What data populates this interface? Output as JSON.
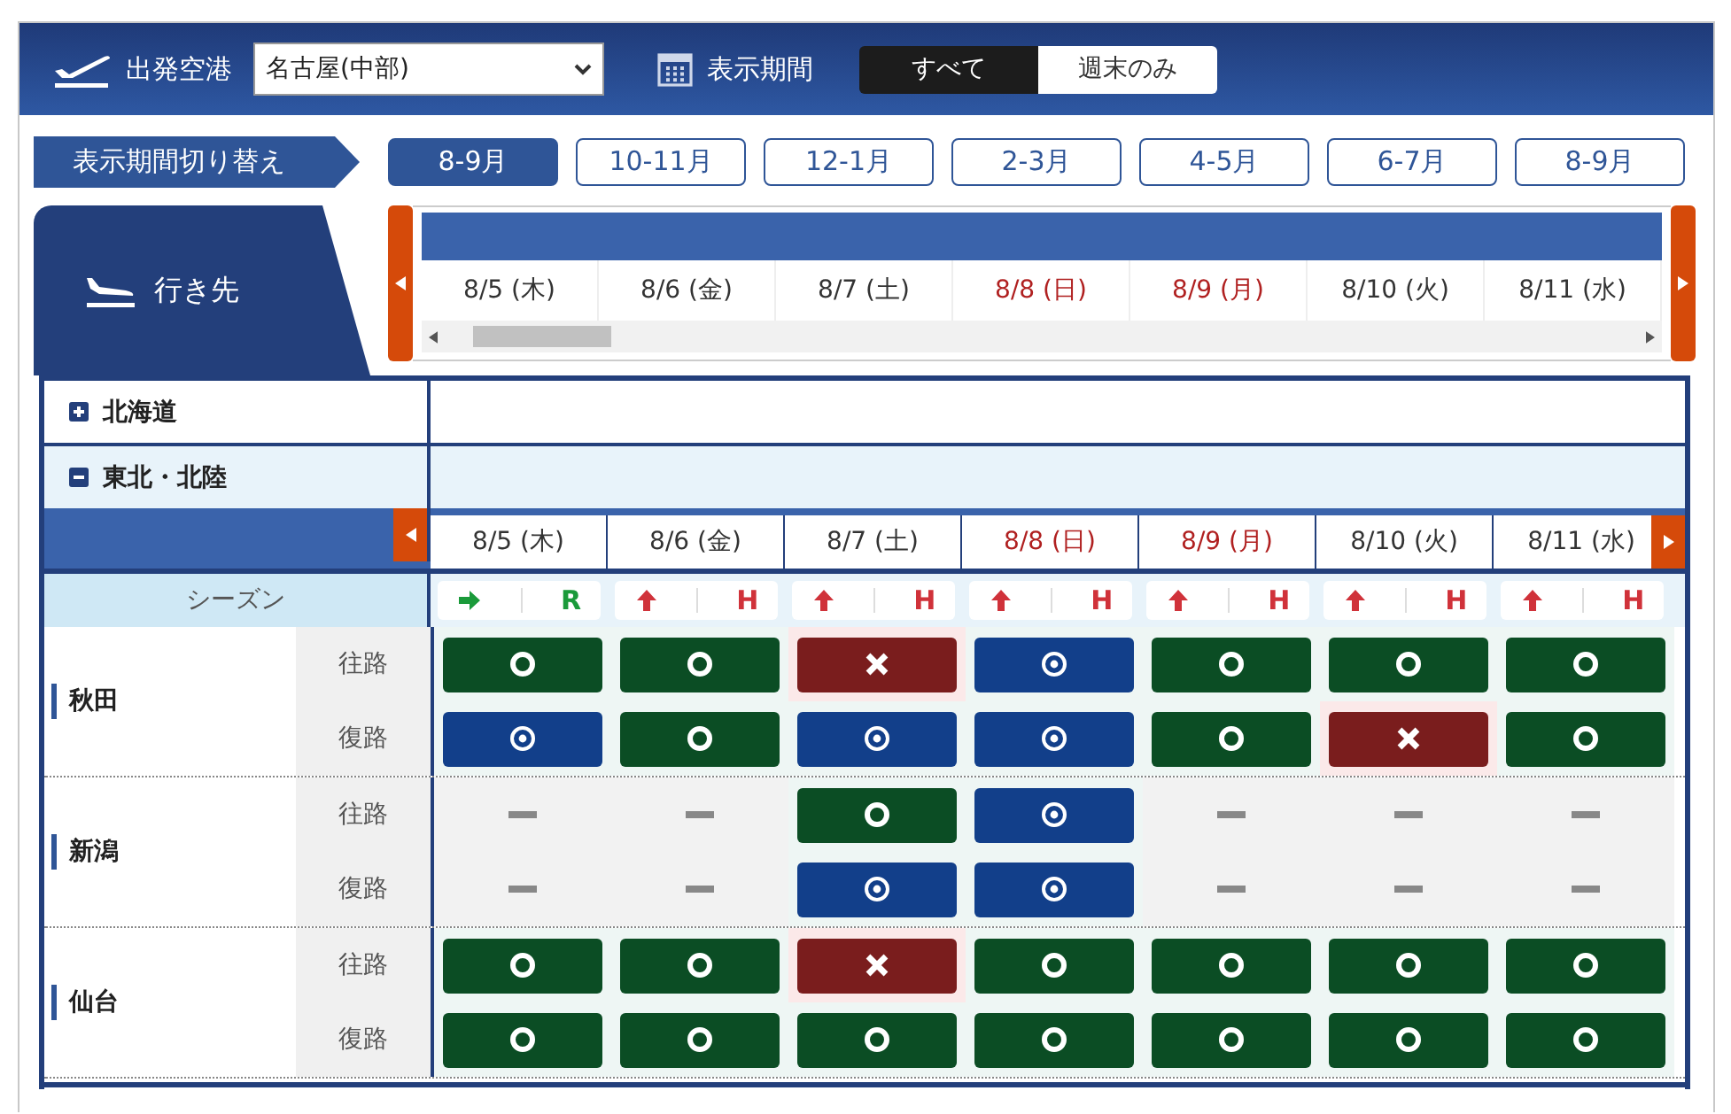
{
  "header": {
    "departure_label": "出発空港",
    "departure_value": "名古屋(中部)",
    "period_label": "表示期間",
    "period_options": [
      {
        "label": "すべて",
        "selected": true
      },
      {
        "label": "週末のみ",
        "selected": false
      }
    ]
  },
  "period_switch": {
    "label": "表示期間切り替え",
    "tabs": [
      {
        "label": "8-9月",
        "selected": true
      },
      {
        "label": "10-11月",
        "selected": false
      },
      {
        "label": "12-1月",
        "selected": false
      },
      {
        "label": "2-3月",
        "selected": false
      },
      {
        "label": "4-5月",
        "selected": false
      },
      {
        "label": "6-7月",
        "selected": false
      },
      {
        "label": "8-9月",
        "selected": false
      }
    ]
  },
  "destination_tab": {
    "label": "行き先"
  },
  "date_strip": [
    {
      "label": "8/5 (木)",
      "holiday": false
    },
    {
      "label": "8/6 (金)",
      "holiday": false
    },
    {
      "label": "8/7 (土)",
      "holiday": false
    },
    {
      "label": "8/8 (日)",
      "holiday": true
    },
    {
      "label": "8/9 (月)",
      "holiday": true
    },
    {
      "label": "8/10 (火)",
      "holiday": false
    },
    {
      "label": "8/11 (水)",
      "holiday": false
    }
  ],
  "regions": [
    {
      "name": "北海道",
      "expanded": false
    },
    {
      "name": "東北・北陸",
      "expanded": true,
      "dates": [
        {
          "label": "8/5 (木)",
          "holiday": false
        },
        {
          "label": "8/6 (金)",
          "holiday": false
        },
        {
          "label": "8/7 (土)",
          "holiday": false
        },
        {
          "label": "8/8 (日)",
          "holiday": true
        },
        {
          "label": "8/9 (月)",
          "holiday": true
        },
        {
          "label": "8/10 (火)",
          "holiday": false
        },
        {
          "label": "8/11 (水)",
          "holiday": false
        }
      ],
      "season_label": "シーズン",
      "seasons": [
        {
          "kind": "right",
          "code": "R"
        },
        {
          "kind": "up",
          "code": "H"
        },
        {
          "kind": "up",
          "code": "H"
        },
        {
          "kind": "up",
          "code": "H"
        },
        {
          "kind": "up",
          "code": "H"
        },
        {
          "kind": "up",
          "code": "H"
        },
        {
          "kind": "up",
          "code": "H"
        }
      ],
      "cities": [
        {
          "name": "秋田",
          "routes": [
            {
              "label": "往路",
              "cells": [
                {
                  "kind": "circle"
                },
                {
                  "kind": "circle"
                },
                {
                  "kind": "cross"
                },
                {
                  "kind": "double"
                },
                {
                  "kind": "circle"
                },
                {
                  "kind": "circle"
                },
                {
                  "kind": "circle"
                }
              ]
            },
            {
              "label": "復路",
              "cells": [
                {
                  "kind": "double"
                },
                {
                  "kind": "circle"
                },
                {
                  "kind": "double"
                },
                {
                  "kind": "double"
                },
                {
                  "kind": "circle"
                },
                {
                  "kind": "cross"
                },
                {
                  "kind": "circle"
                }
              ]
            }
          ]
        },
        {
          "name": "新潟",
          "routes": [
            {
              "label": "往路",
              "cells": [
                {
                  "kind": "none"
                },
                {
                  "kind": "none"
                },
                {
                  "kind": "circle"
                },
                {
                  "kind": "double"
                },
                {
                  "kind": "none"
                },
                {
                  "kind": "none"
                },
                {
                  "kind": "none"
                }
              ]
            },
            {
              "label": "復路",
              "cells": [
                {
                  "kind": "none"
                },
                {
                  "kind": "none"
                },
                {
                  "kind": "double"
                },
                {
                  "kind": "double"
                },
                {
                  "kind": "none"
                },
                {
                  "kind": "none"
                },
                {
                  "kind": "none"
                }
              ]
            }
          ]
        },
        {
          "name": "仙台",
          "routes": [
            {
              "label": "往路",
              "cells": [
                {
                  "kind": "circle"
                },
                {
                  "kind": "circle"
                },
                {
                  "kind": "cross"
                },
                {
                  "kind": "circle"
                },
                {
                  "kind": "circle"
                },
                {
                  "kind": "circle"
                },
                {
                  "kind": "circle"
                }
              ]
            },
            {
              "label": "復路",
              "cells": [
                {
                  "kind": "circle"
                },
                {
                  "kind": "circle"
                },
                {
                  "kind": "circle"
                },
                {
                  "kind": "circle"
                },
                {
                  "kind": "circle"
                },
                {
                  "kind": "circle"
                },
                {
                  "kind": "circle"
                }
              ]
            }
          ]
        }
      ]
    }
  ]
}
